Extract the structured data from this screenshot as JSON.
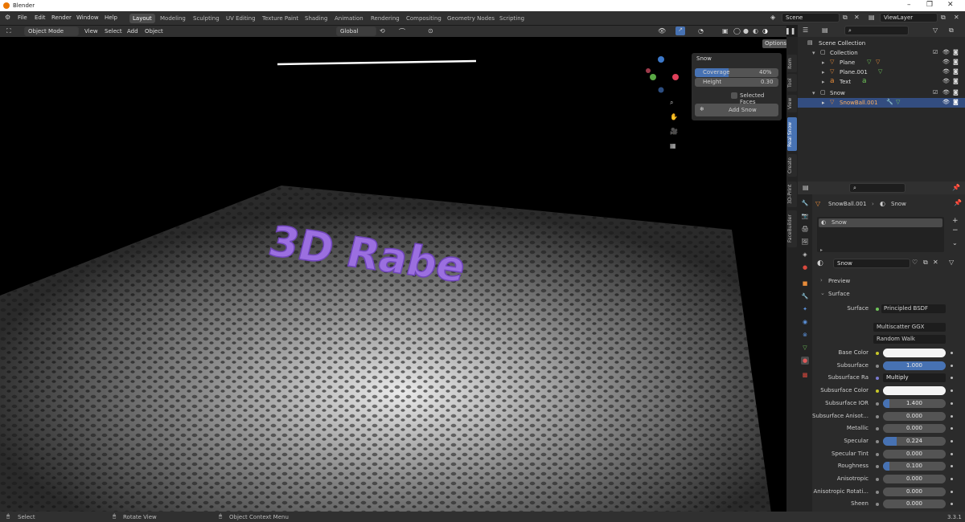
{
  "window": {
    "title": "Blender"
  },
  "menu": {
    "items": [
      "File",
      "Edit",
      "Render",
      "Window",
      "Help"
    ]
  },
  "workspaces": [
    "Layout",
    "Modeling",
    "Sculpting",
    "UV Editing",
    "Texture Paint",
    "Shading",
    "Animation",
    "Rendering",
    "Compositing",
    "Geometry Nodes",
    "Scripting"
  ],
  "scene": {
    "name": "Scene",
    "view_layer": "ViewLayer"
  },
  "viewport_header": {
    "mode": "Object Mode",
    "menus": [
      "View",
      "Select",
      "Add",
      "Object"
    ],
    "orientation": "Global",
    "options": "Options"
  },
  "npanel": {
    "title": "Snow",
    "coverage_label": "Coverage",
    "coverage_value": "40%",
    "coverage_level": 0.4,
    "height_label": "Height",
    "height_value": "0.30",
    "selected_faces": "Selected Faces",
    "add_snow": "Add Snow"
  },
  "side_tabs": [
    "Item",
    "Tool",
    "View",
    "Real Snow",
    "Create",
    "3D-Print",
    "FaceBuilder"
  ],
  "viewport_scene": {
    "text_object": "3D Rabe"
  },
  "outliner": {
    "root": "Scene Collection",
    "rows": [
      {
        "name": "Collection",
        "kind": "collection"
      },
      {
        "name": "Plane",
        "kind": "mesh"
      },
      {
        "name": "Plane.001",
        "kind": "mesh"
      },
      {
        "name": "Text",
        "kind": "text"
      },
      {
        "name": "Snow",
        "kind": "collection"
      },
      {
        "name": "SnowBall.001",
        "kind": "metaball",
        "selected": true
      }
    ]
  },
  "properties": {
    "breadcrumb_object": "SnowBall.001",
    "breadcrumb_material": "Snow",
    "slot_name": "Snow",
    "material_name": "Snow",
    "preview": "Preview",
    "surface_section": "Surface",
    "surface_label": "Surface",
    "surface_value": "Principled BSDF",
    "distribution": "Multiscatter GGX",
    "subsurface_method": "Random Walk",
    "rows": [
      {
        "label": "Base Color",
        "value": "",
        "type": "color"
      },
      {
        "label": "Subsurface",
        "value": "1.000",
        "fill": 1.0
      },
      {
        "label": "Subsurface Ra",
        "value": "Multiply",
        "type": "link"
      },
      {
        "label": "Subsurface Color",
        "value": "",
        "type": "color"
      },
      {
        "label": "Subsurface IOR",
        "value": "1.400",
        "fill": 0.1
      },
      {
        "label": "Subsurface Anisot...",
        "value": "0.000",
        "fill": 0
      },
      {
        "label": "Metallic",
        "value": "0.000",
        "fill": 0
      },
      {
        "label": "Specular",
        "value": "0.224",
        "fill": 0.224
      },
      {
        "label": "Specular Tint",
        "value": "0.000",
        "fill": 0
      },
      {
        "label": "Roughness",
        "value": "0.100",
        "fill": 0.1
      },
      {
        "label": "Anisotropic",
        "value": "0.000",
        "fill": 0
      },
      {
        "label": "Anisotropic Rotati...",
        "value": "0.000",
        "fill": 0
      },
      {
        "label": "Sheen",
        "value": "0.000",
        "fill": 0
      }
    ]
  },
  "statusbar": {
    "select": "Select",
    "rotate": "Rotate View",
    "context": "Object Context Menu",
    "version": "3.3.1"
  },
  "colors": {
    "accent": "#4772b3",
    "text_purple": "#9b6fe0",
    "snow": "#d8d8d8"
  }
}
